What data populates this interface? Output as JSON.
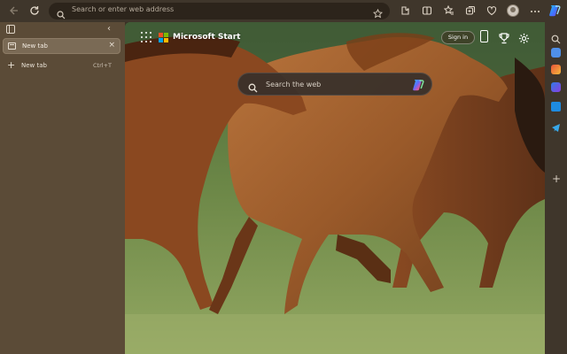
{
  "browser": {
    "address_placeholder": "Search or enter web address"
  },
  "sidebar": {
    "tabs": [
      {
        "title": "New tab",
        "active": true,
        "close_glyph": "×"
      }
    ],
    "new_tab": {
      "label": "New tab",
      "shortcut": "Ctrl+T"
    }
  },
  "page": {
    "brand": "Microsoft Start",
    "signin_label": "Sign in",
    "search_placeholder": "Search the web"
  },
  "icons": {
    "toolbar": [
      "back-icon",
      "refresh-icon",
      "search-icon",
      "favorite-star-icon",
      "extensions-icon",
      "split-screen-icon",
      "favorites-icon",
      "collections-icon",
      "browser-essentials-icon",
      "profile-avatar",
      "copilot-icon"
    ],
    "page": [
      "apps-grid-icon",
      "microsoft-logo",
      "phone-icon",
      "rewards-trophy-icon",
      "settings-gear-icon",
      "copilot-icon"
    ],
    "rightbar": [
      "search-sidebar-icon",
      "shopping-icon",
      "office-icon",
      "games-icon",
      "outlook-icon",
      "telegram-icon",
      "add-icon"
    ]
  },
  "colors": {
    "toolbar_bg": "#3f362b",
    "sidebar_bg": "#5b4b37",
    "active_tab_bg": "#7a6a55",
    "ms_red": "#f25022",
    "ms_green": "#7fba00",
    "ms_blue": "#00a4ef",
    "ms_yellow": "#ffb900"
  }
}
